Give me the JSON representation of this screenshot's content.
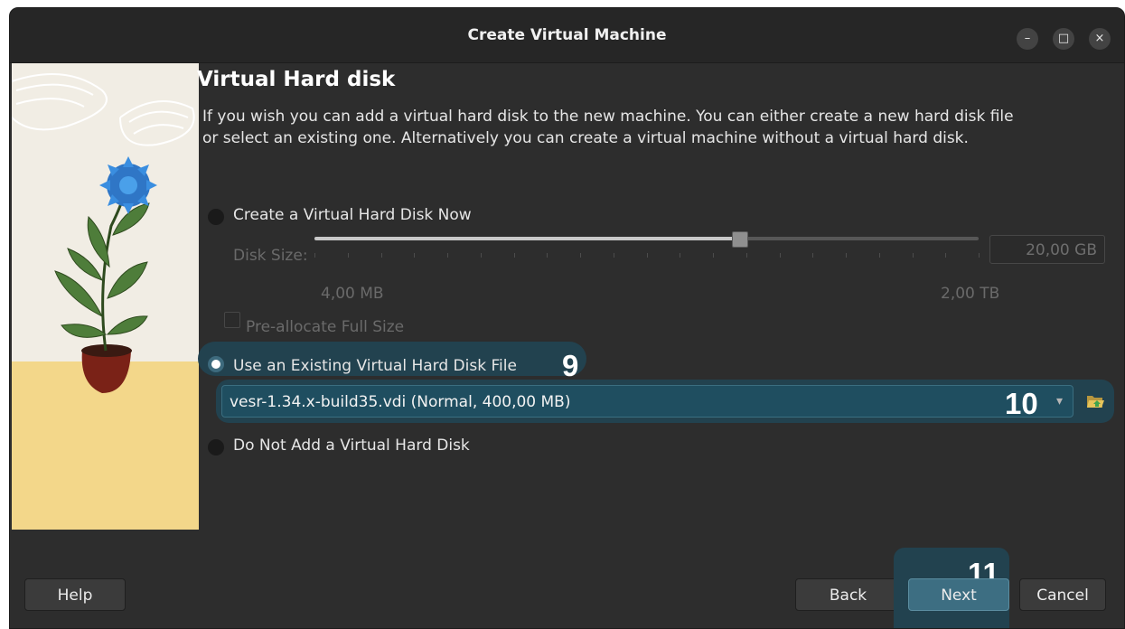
{
  "window": {
    "title": "Create Virtual Machine",
    "controls": {
      "minimize": "–",
      "maximize": "□",
      "close": "×"
    }
  },
  "page": {
    "heading": "Virtual Hard disk",
    "description": "If you wish you can add a virtual hard disk to the new machine. You can either create a new hard disk file or select an existing one. Alternatively you can create a virtual machine without a virtual hard disk."
  },
  "options": {
    "create_now": {
      "label": "Create a Virtual Hard Disk Now",
      "selected": false
    },
    "use_existing": {
      "label": "Use an Existing Virtual Hard Disk File",
      "selected": true
    },
    "do_not_add": {
      "label": "Do Not Add a Virtual Hard Disk",
      "selected": false
    }
  },
  "disk_size": {
    "label": "Disk Size:",
    "value": "20,00 GB",
    "min_label": "4,00 MB",
    "max_label": "2,00 TB",
    "slider_fraction": 0.64,
    "enabled": false
  },
  "preallocate": {
    "label": "Pre-allocate Full Size",
    "checked": false,
    "enabled": false
  },
  "existing_disk": {
    "selected": "vesr-1.34.x-build35.vdi (Normal, 400,00 MB)"
  },
  "annotations": {
    "step9": "9",
    "step10": "10",
    "step11": "11"
  },
  "buttons": {
    "help": "Help",
    "back": "Back",
    "next": "Next",
    "cancel": "Cancel"
  },
  "colors": {
    "accent": "#3d6e82",
    "highlight": "#22424f",
    "background": "#2d2d2d"
  },
  "icons": {
    "folder": "folder-open-icon",
    "dropdown": "chevron-down-icon"
  }
}
